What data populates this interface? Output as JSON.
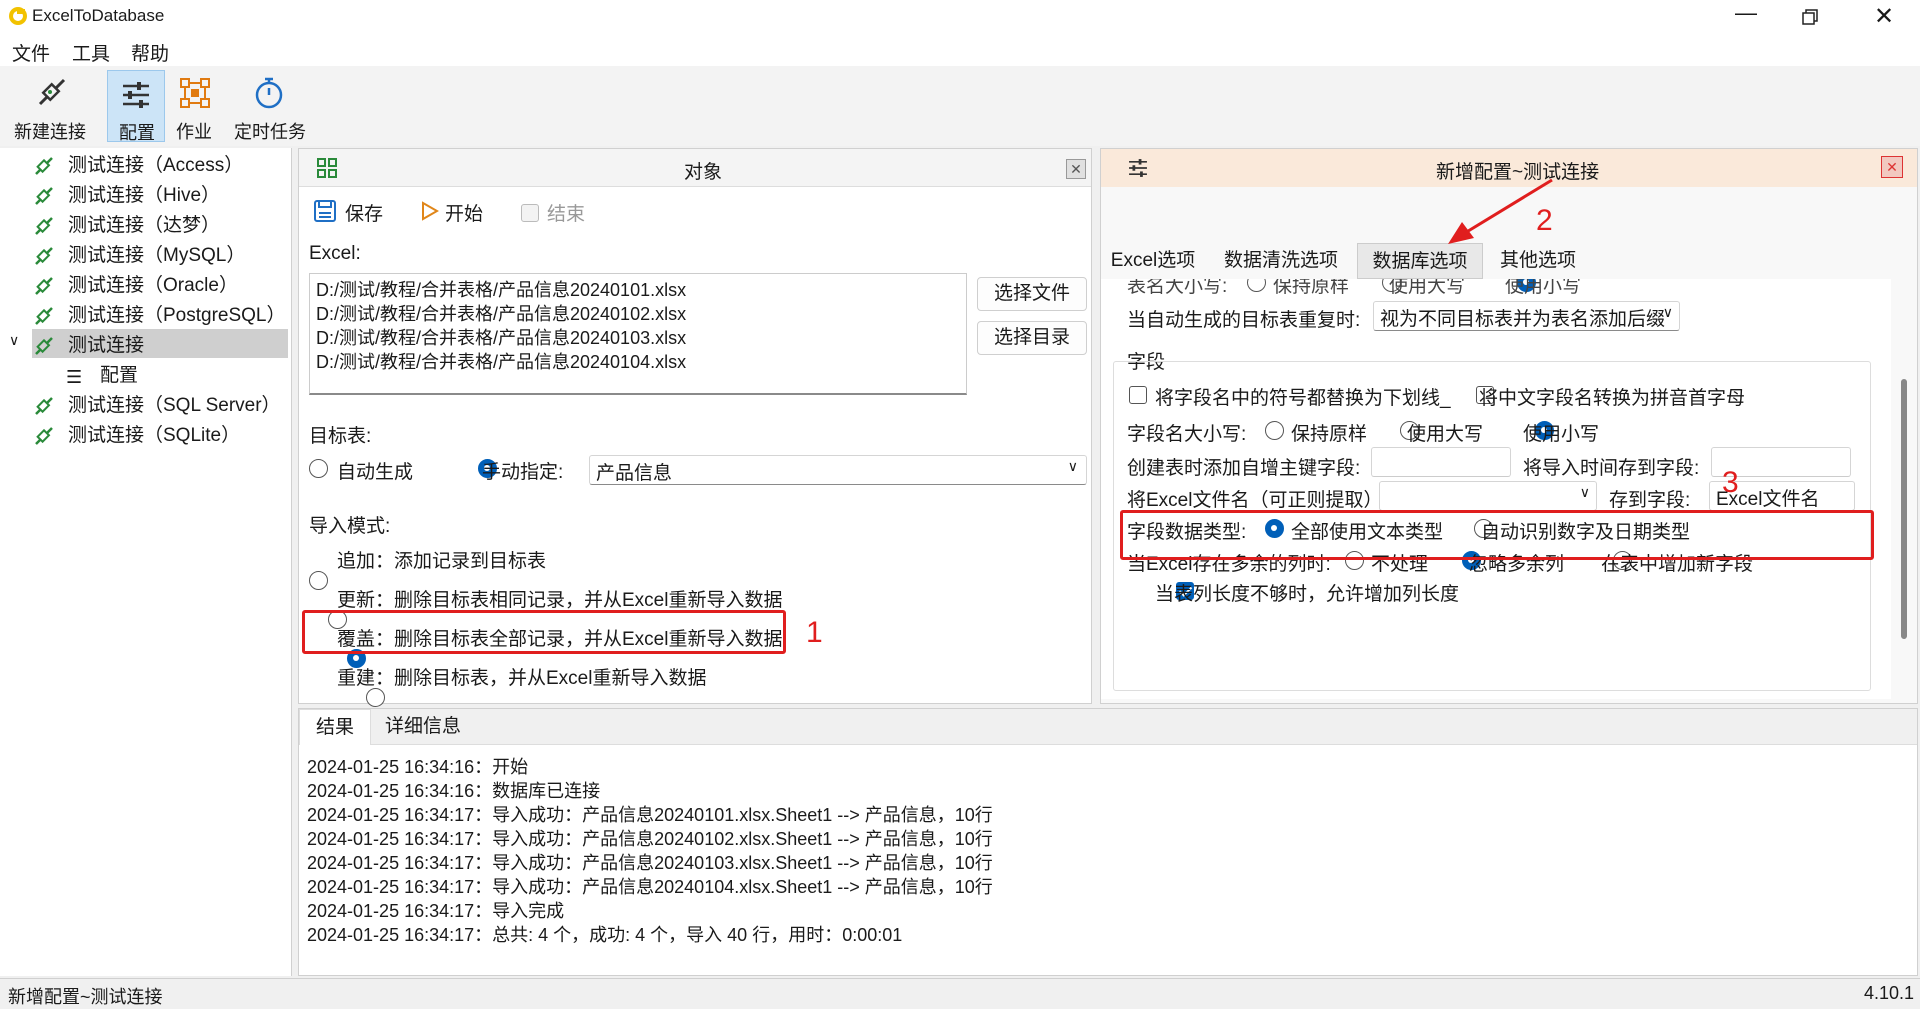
{
  "app": {
    "title": "ExcelToDatabase",
    "version": "4.10.1",
    "status": "新增配置~测试连接"
  },
  "menu": [
    "文件",
    "工具",
    "帮助"
  ],
  "toolbar": {
    "new_conn": "新建连接",
    "config": "配置",
    "job": "作业",
    "schedule": "定时任务"
  },
  "tree": {
    "items": [
      "测试连接（Access）",
      "测试连接（Hive）",
      "测试连接（达梦）",
      "测试连接（MySQL）",
      "测试连接（Oracle）",
      "测试连接（PostgreSQL）",
      "测试连接",
      "配置",
      "测试连接（SQL Server）",
      "测试连接（SQLite）"
    ]
  },
  "object_panel": {
    "title": "对象",
    "save": "保存",
    "start": "开始",
    "end": "结束",
    "excel_label": "Excel:",
    "files": [
      "D:/测试/教程/合并表格/产品信息20240101.xlsx",
      "D:/测试/教程/合并表格/产品信息20240102.xlsx",
      "D:/测试/教程/合并表格/产品信息20240103.xlsx",
      "D:/测试/教程/合并表格/产品信息20240104.xlsx"
    ],
    "select_file": "选择文件",
    "select_dir": "选择目录",
    "target_label": "目标表:",
    "auto_gen": "自动生成",
    "manual": "手动指定:",
    "target_value": "产品信息",
    "mode_label": "导入模式:",
    "modes": [
      "追加：添加记录到目标表",
      "更新：删除目标表相同记录，并从Excel重新导入数据",
      "覆盖：删除目标表全部记录，并从Excel重新导入数据",
      "重建：删除目标表，并从Excel重新导入数据"
    ]
  },
  "config_panel": {
    "title": "新增配置~测试连接",
    "tabs": [
      "Excel选项",
      "数据清洗选项",
      "数据库选项",
      "其他选项"
    ],
    "case_partial": {
      "label": "表名大小写:",
      "opts": [
        "保持原样",
        "使用大写",
        "使用小写"
      ]
    },
    "dup_label": "当自动生成的目标表重复时:",
    "dup_value": "视为不同目标表并为表名添加后缀",
    "fields_title": "字段",
    "chk_symbol": "将字段名中的符号都替换为下划线_",
    "chk_pinyin": "将中文字段名转换为拼音首字母",
    "field_case": {
      "label": "字段名大小写:",
      "opts": [
        "保持原样",
        "使用大写",
        "使用小写"
      ]
    },
    "auto_pk": "创建表时添加自增主键字段:",
    "import_time": "将导入时间存到字段:",
    "filename_label": "将Excel文件名（可正则提取）",
    "save_to": "存到字段:",
    "save_to_value": "Excel文件名",
    "dtype": {
      "label": "字段数据类型:",
      "opts": [
        "全部使用文本类型",
        "自动识别数字及日期类型"
      ]
    },
    "extra": {
      "label": "当Excel存在多余的列时:",
      "opts": [
        "不处理",
        "忽略多余列",
        "在表中增加新字段"
      ]
    },
    "chk_extend": "当表列长度不够时，允许增加列长度"
  },
  "bottom": {
    "tabs": [
      "结果",
      "详细信息"
    ],
    "log": [
      "2024-01-25 16:34:16：开始",
      "2024-01-25 16:34:16：数据库已连接",
      "2024-01-25 16:34:17：导入成功：产品信息20240101.xlsx.Sheet1 --> 产品信息，10行",
      "2024-01-25 16:34:17：导入成功：产品信息20240102.xlsx.Sheet1 --> 产品信息，10行",
      "2024-01-25 16:34:17：导入成功：产品信息20240103.xlsx.Sheet1 --> 产品信息，10行",
      "2024-01-25 16:34:17：导入成功：产品信息20240104.xlsx.Sheet1 --> 产品信息，10行",
      "2024-01-25 16:34:17：导入完成",
      "2024-01-25 16:34:17：总共: 4 个，成功: 4 个，导入 40 行，用时：0:00:01"
    ]
  },
  "annotations": [
    "1",
    "2",
    "3"
  ],
  "colors": {
    "accent": "#005fb8",
    "annotation": "#e01e1e"
  }
}
